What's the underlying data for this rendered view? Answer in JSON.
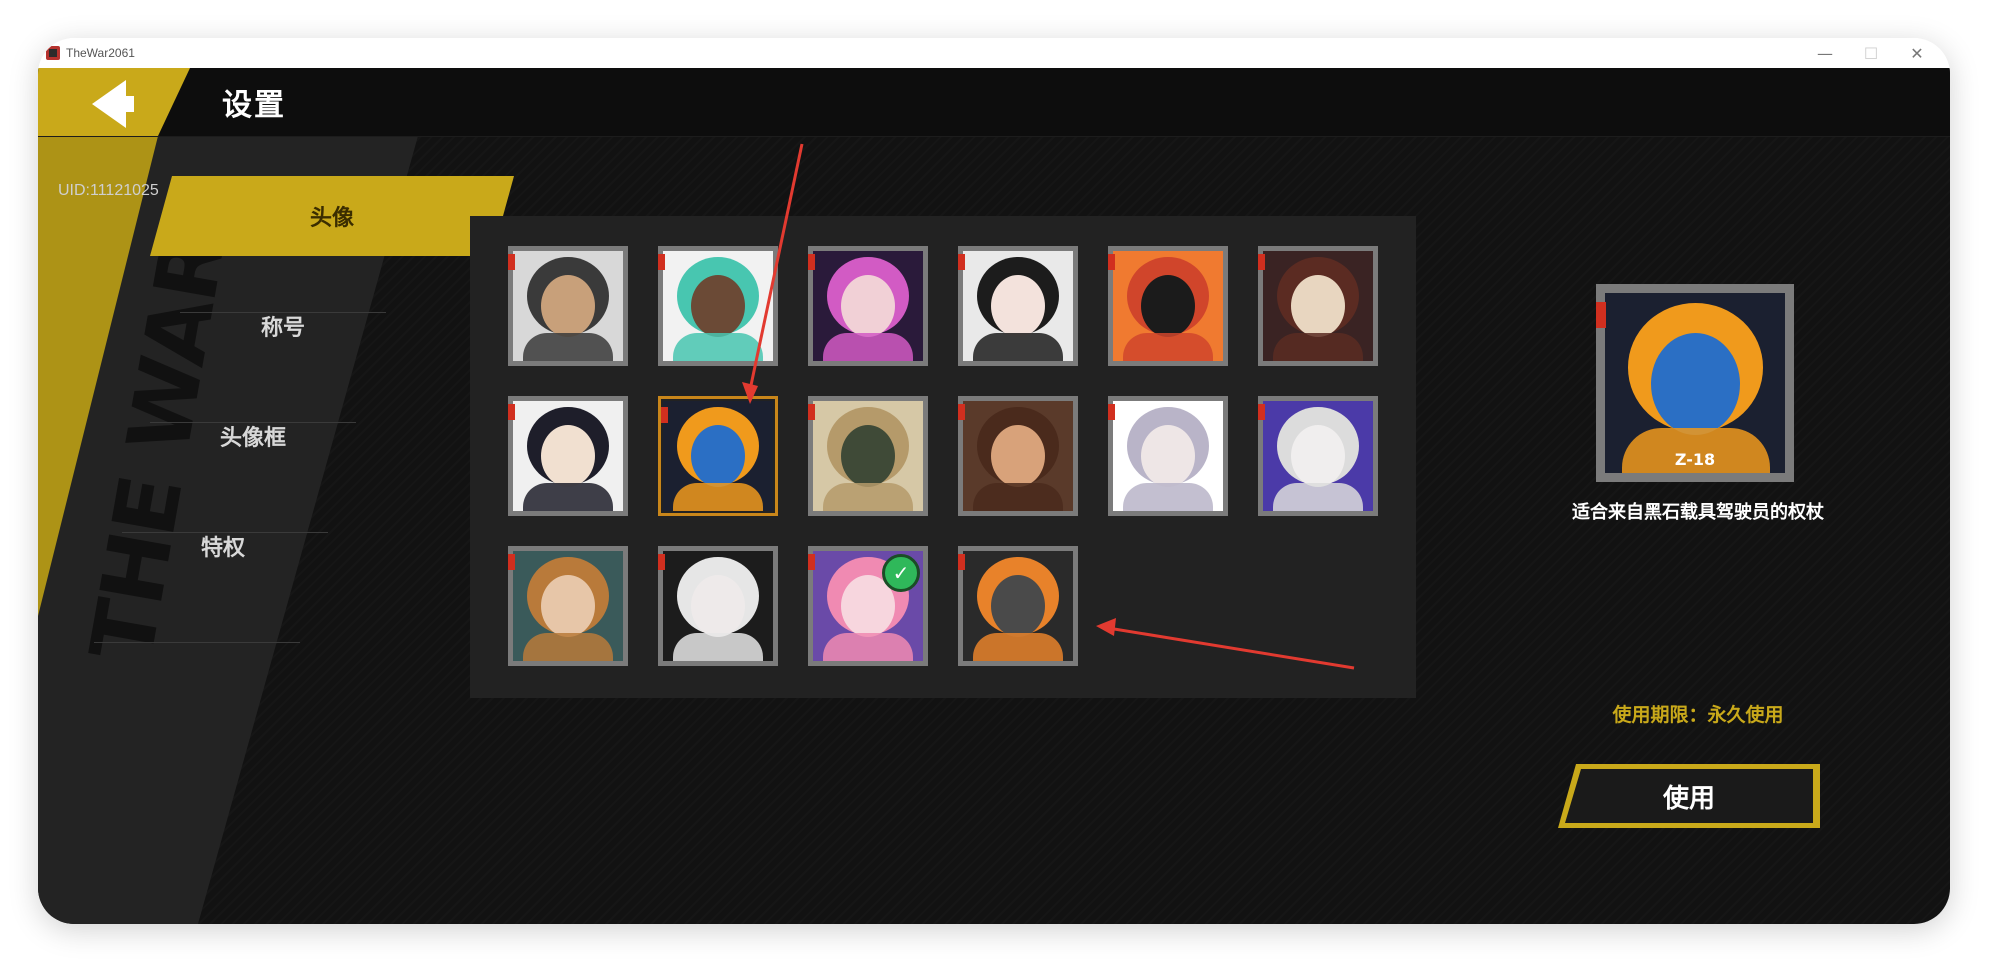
{
  "window": {
    "title": "TheWar2061",
    "controls": [
      "minimize",
      "maximize",
      "close"
    ],
    "minimize_glyph": "—",
    "maximize_glyph": "☐",
    "close_glyph": "✕"
  },
  "header": {
    "title": "设置"
  },
  "sidebar": {
    "logo": "THE WAR",
    "uid": "UID:11121025",
    "items": [
      {
        "label": "头像",
        "active": true
      },
      {
        "label": "称号",
        "active": false
      },
      {
        "label": "头像框",
        "active": false
      },
      {
        "label": "特权",
        "active": false
      }
    ]
  },
  "avatars": [
    {
      "name": "avatar-masked-soldier",
      "selected": false,
      "equipped": false,
      "skin": "#c8a07a",
      "hair": "#3a3a3a",
      "bg": "#d8d8d8"
    },
    {
      "name": "avatar-teal-hair-girl",
      "selected": false,
      "equipped": false,
      "skin": "#6b4a36",
      "hair": "#48c6b0",
      "bg": "#f2f2f2"
    },
    {
      "name": "avatar-pink-hair-girl",
      "selected": false,
      "equipped": false,
      "skin": "#f1d0d6",
      "hair": "#d25bc4",
      "bg": "#2a1a3a"
    },
    {
      "name": "avatar-black-hair-girl",
      "selected": false,
      "equipped": false,
      "skin": "#f3e2dc",
      "hair": "#1c1c1c",
      "bg": "#e9e9e9"
    },
    {
      "name": "avatar-black-mask-red",
      "selected": false,
      "equipped": false,
      "skin": "#1b1b1b",
      "hair": "#d0452b",
      "bg": "#f07a30"
    },
    {
      "name": "avatar-skull-mask",
      "selected": false,
      "equipped": false,
      "skin": "#e8d6c0",
      "hair": "#5b2b22",
      "bg": "#3a2323"
    },
    {
      "name": "avatar-white-hair-boy",
      "selected": false,
      "equipped": false,
      "skin": "#f1e0d0",
      "hair": "#1e1e2a",
      "bg": "#f0f0f0"
    },
    {
      "name": "avatar-z18-pilot",
      "selected": true,
      "equipped": false,
      "skin": "#2b6fc4",
      "hair": "#f09a1c",
      "bg": "#1b2030"
    },
    {
      "name": "avatar-gas-mask",
      "selected": false,
      "equipped": false,
      "skin": "#3f4a37",
      "hair": "#b59a6a",
      "bg": "#d6c8a6"
    },
    {
      "name": "avatar-brown-hair-grin",
      "selected": false,
      "equipped": false,
      "skin": "#d8a27a",
      "hair": "#4a2a1c",
      "bg": "#5a3a2a"
    },
    {
      "name": "avatar-silver-hair-profile",
      "selected": false,
      "equipped": false,
      "skin": "#eee6e6",
      "hair": "#b9b4c8",
      "bg": "#ffffff"
    },
    {
      "name": "avatar-white-officer",
      "selected": false,
      "equipped": false,
      "skin": "#f0eeee",
      "hair": "#dcdcdc",
      "bg": "#4b3aa8"
    },
    {
      "name": "avatar-goggles-girl",
      "selected": false,
      "equipped": false,
      "skin": "#e7c6a8",
      "hair": "#b97a3a",
      "bg": "#3a5a5a"
    },
    {
      "name": "avatar-white-hat-girl",
      "selected": false,
      "equipped": false,
      "skin": "#eeeaea",
      "hair": "#e6e6e6",
      "bg": "#1c1c1c"
    },
    {
      "name": "avatar-pink-cat-girl",
      "selected": false,
      "equipped": true,
      "skin": "#f7d6de",
      "hair": "#f08ab2",
      "bg": "#6a4aa8"
    },
    {
      "name": "avatar-robot-mech",
      "selected": false,
      "equipped": false,
      "skin": "#4a4a4a",
      "hair": "#e8822a",
      "bg": "#2a2a2a"
    }
  ],
  "preview": {
    "name": "avatar-z18-pilot",
    "badge_text": "Z-18",
    "description": "适合来自黑石载具驾驶员的权杖",
    "duration": "使用期限：永久使用",
    "use_button": "使用"
  },
  "colors": {
    "accent": "#c9a91a",
    "selected_border": "#c9861a",
    "corner_marker": "#d12f1f",
    "equipped_check": "#2fb85a",
    "annotation": "#e23a30"
  }
}
